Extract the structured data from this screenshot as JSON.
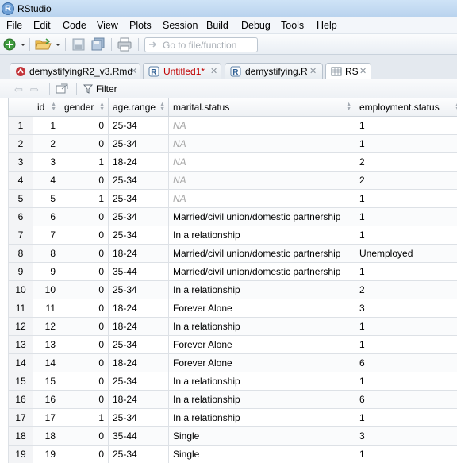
{
  "window": {
    "title": "RStudio",
    "app_icon": "R"
  },
  "menu": [
    "File",
    "Edit",
    "Code",
    "View",
    "Plots",
    "Session",
    "Build",
    "Debug",
    "Tools",
    "Help"
  ],
  "toolbar": {
    "goto_placeholder": "Go to file/function"
  },
  "tabs": [
    {
      "label": "demystifyingR2_v3.Rmd",
      "icon": "rmd-file-icon",
      "color": "#000000",
      "active": false
    },
    {
      "label": "Untitled1*",
      "icon": "r-script-icon",
      "color": "#c00000",
      "active": false
    },
    {
      "label": "demystifying.R",
      "icon": "r-script-icon",
      "color": "#000000",
      "active": false
    },
    {
      "label": "RS",
      "icon": "table-icon",
      "color": "#000000",
      "active": true
    }
  ],
  "grid_toolbar": {
    "filter_label": "Filter"
  },
  "table": {
    "columns": [
      "id",
      "gender",
      "age.range",
      "marital.status",
      "employment.status"
    ],
    "rows": [
      [
        "1",
        "1",
        "0",
        "25-34",
        "NA",
        "1"
      ],
      [
        "2",
        "2",
        "0",
        "25-34",
        "NA",
        "1"
      ],
      [
        "3",
        "3",
        "1",
        "18-24",
        "NA",
        "2"
      ],
      [
        "4",
        "4",
        "0",
        "25-34",
        "NA",
        "2"
      ],
      [
        "5",
        "5",
        "1",
        "25-34",
        "NA",
        "1"
      ],
      [
        "6",
        "6",
        "0",
        "25-34",
        "Married/civil union/domestic partnership",
        "1"
      ],
      [
        "7",
        "7",
        "0",
        "25-34",
        "In a relationship",
        "1"
      ],
      [
        "8",
        "8",
        "0",
        "18-24",
        "Married/civil union/domestic partnership",
        "Unemployed"
      ],
      [
        "9",
        "9",
        "0",
        "35-44",
        "Married/civil union/domestic partnership",
        "1"
      ],
      [
        "10",
        "10",
        "0",
        "25-34",
        "In a relationship",
        "2"
      ],
      [
        "11",
        "11",
        "0",
        "18-24",
        "Forever Alone",
        "3"
      ],
      [
        "12",
        "12",
        "0",
        "18-24",
        "In a relationship",
        "1"
      ],
      [
        "13",
        "13",
        "0",
        "25-34",
        "Forever Alone",
        "1"
      ],
      [
        "14",
        "14",
        "0",
        "18-24",
        "Forever Alone",
        "6"
      ],
      [
        "15",
        "15",
        "0",
        "25-34",
        "In a relationship",
        "1"
      ],
      [
        "16",
        "16",
        "0",
        "18-24",
        "In a relationship",
        "6"
      ],
      [
        "17",
        "17",
        "1",
        "25-34",
        "In a relationship",
        "1"
      ],
      [
        "18",
        "18",
        "0",
        "35-44",
        "Single",
        "3"
      ],
      [
        "19",
        "19",
        "0",
        "25-34",
        "Single",
        "1"
      ]
    ]
  }
}
